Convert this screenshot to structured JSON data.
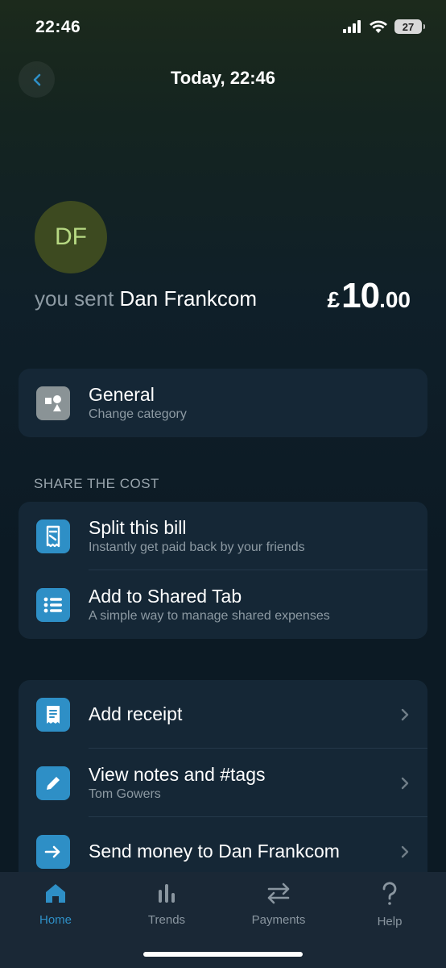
{
  "status_bar": {
    "time": "22:46",
    "battery": "27"
  },
  "header": {
    "title": "Today, 22:46"
  },
  "transaction": {
    "initials": "DF",
    "prefix": "you sent",
    "name": "Dan Frankcom",
    "currency": "£",
    "amount_major": "10",
    "amount_minor": ".00"
  },
  "category": {
    "title": "General",
    "subtitle": "Change category"
  },
  "share_section": {
    "header": "SHARE THE COST",
    "items": [
      {
        "title": "Split this bill",
        "subtitle": "Instantly get paid back by your friends"
      },
      {
        "title": "Add to Shared Tab",
        "subtitle": "A simple way to manage shared expenses"
      }
    ]
  },
  "actions": {
    "items": [
      {
        "title": "Add receipt",
        "subtitle": ""
      },
      {
        "title": "View notes and #tags",
        "subtitle": "Tom Gowers"
      },
      {
        "title": "Send money to Dan Frankcom",
        "subtitle": ""
      }
    ]
  },
  "tab_bar": {
    "active": "Home",
    "items": [
      {
        "label": "Home"
      },
      {
        "label": "Trends"
      },
      {
        "label": "Payments"
      },
      {
        "label": "Help"
      }
    ]
  },
  "colors": {
    "accent": "#2e8fc6",
    "avatar_bg": "#3d4a20",
    "avatar_text": "#b7d983",
    "card": "#152736"
  }
}
